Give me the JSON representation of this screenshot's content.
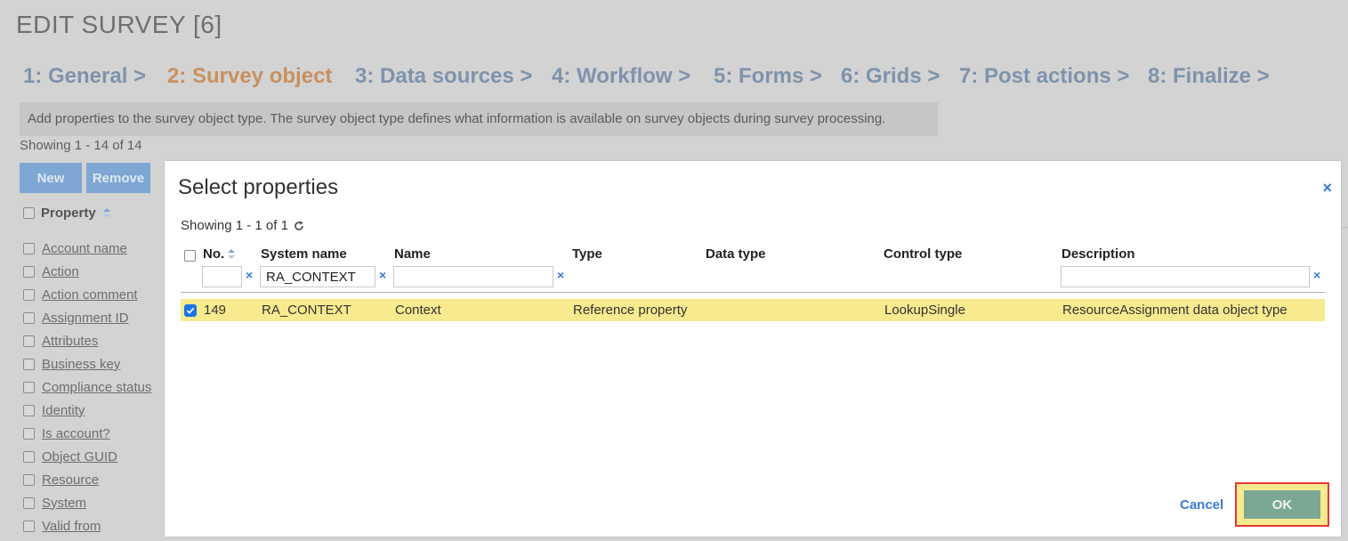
{
  "page": {
    "title": "EDIT SURVEY [6]",
    "steps": [
      {
        "label": "1: General >",
        "active": false
      },
      {
        "label": "2: Survey object",
        "active": true
      },
      {
        "label": "3: Data sources >",
        "active": false
      },
      {
        "label": "4: Workflow >",
        "active": false
      },
      {
        "label": "5: Forms >",
        "active": false
      },
      {
        "label": "6: Grids >",
        "active": false
      },
      {
        "label": "7: Post actions >",
        "active": false
      },
      {
        "label": "8: Finalize >",
        "active": false
      }
    ],
    "info": "Add properties to the survey object type. The survey object type defines what information is available on survey objects during survey processing.",
    "showing": "Showing 1 - 14 of 14",
    "buttons": {
      "new": "New",
      "remove": "Remove"
    },
    "list_header": "Property",
    "properties": [
      "Account name",
      "Action",
      "Action comment",
      "Assignment ID",
      "Attributes",
      "Business key",
      "Compliance status",
      "Identity",
      "Is account?",
      "Object GUID",
      "Resource",
      "System",
      "Valid from"
    ]
  },
  "modal": {
    "title": "Select properties",
    "close_icon": "×",
    "showing": "Showing 1 - 1 of 1",
    "columns": {
      "no": "No.",
      "system_name": "System name",
      "name": "Name",
      "type": "Type",
      "data_type": "Data type",
      "control_type": "Control type",
      "description": "Description"
    },
    "filters": {
      "no": "",
      "system_name": "RA_CONTEXT",
      "name": "",
      "description": ""
    },
    "clear_icon": "×",
    "rows": [
      {
        "checked": true,
        "no": "149",
        "system_name": "RA_CONTEXT",
        "name": "Context",
        "type": "Reference property",
        "data_type": "",
        "control_type": "LookupSingle",
        "description": "ResourceAssignment data object type"
      }
    ],
    "cancel": "Cancel",
    "ok": "OK"
  },
  "colors": {
    "active_step": "#c9905f",
    "step": "#7e93ac",
    "selected_row": "#f7ea8f",
    "ok_button": "#7aa894",
    "link": "#3a7bd5",
    "highlight_border": "#e53935"
  }
}
